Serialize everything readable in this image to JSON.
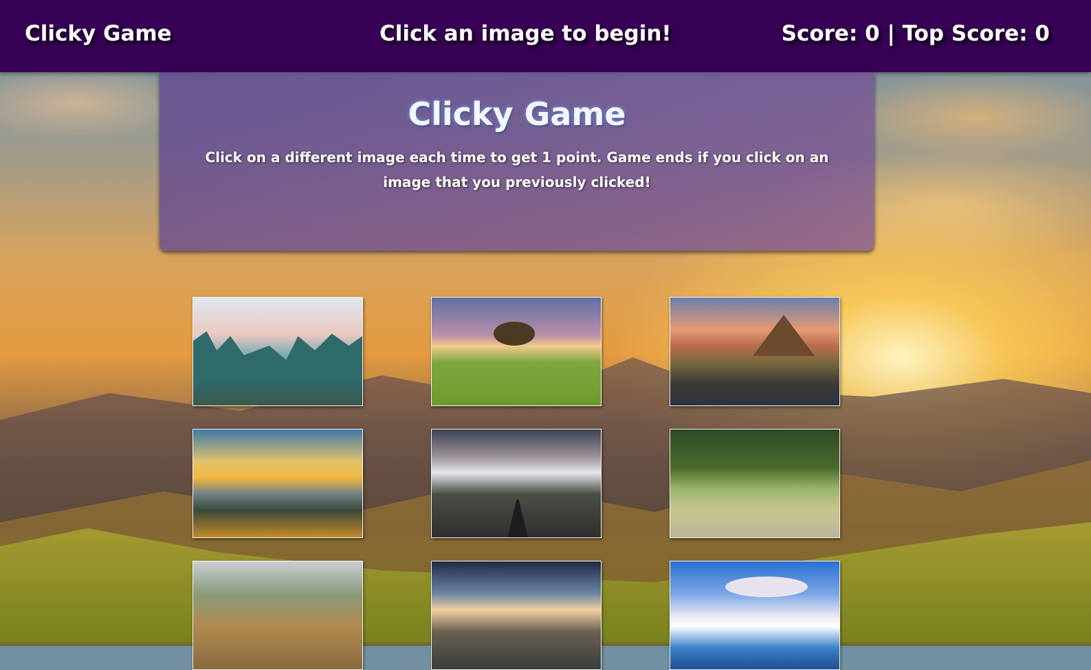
{
  "navbar": {
    "brand": "Clicky Game",
    "message": "Click an image to begin!",
    "score": "Score: 0 | Top Score: 0"
  },
  "jumbotron": {
    "title": "Clicky Game",
    "instructions": "Click on a different image each time to get 1 point. Game ends if you click on an image that you previously clicked!"
  },
  "images": [
    {
      "name": "valley-river"
    },
    {
      "name": "tree-field-sunset"
    },
    {
      "name": "waterfall-mountain"
    },
    {
      "name": "sunrise-lake-flowers"
    },
    {
      "name": "mountain-road"
    },
    {
      "name": "meadow-tree"
    },
    {
      "name": "aerial-boardwalk"
    },
    {
      "name": "coastal-valley"
    },
    {
      "name": "glacier-icebergs"
    }
  ]
}
